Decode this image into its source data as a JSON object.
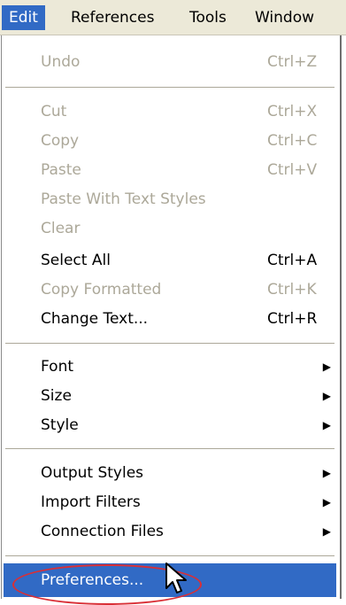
{
  "menubar": {
    "items": [
      {
        "label": "Edit"
      },
      {
        "label": "References"
      },
      {
        "label": "Tools"
      },
      {
        "label": "Window"
      }
    ]
  },
  "menu": {
    "items": [
      {
        "label": "Undo",
        "shortcut": "Ctrl+Z",
        "enabled": false
      },
      {
        "label": "Cut",
        "shortcut": "Ctrl+X",
        "enabled": false
      },
      {
        "label": "Copy",
        "shortcut": "Ctrl+C",
        "enabled": false
      },
      {
        "label": "Paste",
        "shortcut": "Ctrl+V",
        "enabled": false
      },
      {
        "label": "Paste With Text Styles",
        "shortcut": "",
        "enabled": false
      },
      {
        "label": "Clear",
        "shortcut": "",
        "enabled": false
      },
      {
        "label": "Select All",
        "shortcut": "Ctrl+A",
        "enabled": true
      },
      {
        "label": "Copy Formatted",
        "shortcut": "Ctrl+K",
        "enabled": false
      },
      {
        "label": "Change Text...",
        "shortcut": "Ctrl+R",
        "enabled": true
      },
      {
        "label": "Font",
        "submenu": true,
        "enabled": true
      },
      {
        "label": "Size",
        "submenu": true,
        "enabled": true
      },
      {
        "label": "Style",
        "submenu": true,
        "enabled": true
      },
      {
        "label": "Output Styles",
        "submenu": true,
        "enabled": true
      },
      {
        "label": "Import Filters",
        "submenu": true,
        "enabled": true
      },
      {
        "label": "Connection Files",
        "submenu": true,
        "enabled": true
      },
      {
        "label": "Preferences...",
        "enabled": true,
        "highlighted": true
      }
    ]
  },
  "colors": {
    "highlight": "#316ac5",
    "annotation_oval": "#d92f36",
    "disabled_text": "#aca899"
  },
  "icons": {
    "submenu": "triangle-right",
    "cursor": "mouse-pointer-arrow"
  }
}
